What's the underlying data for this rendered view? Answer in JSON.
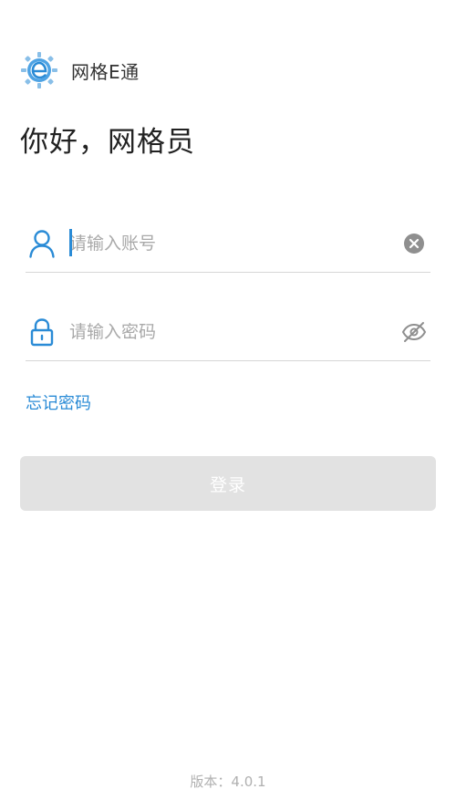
{
  "app": {
    "name": "网格E通"
  },
  "greeting": "你好，网格员",
  "account": {
    "placeholder": "请输入账号",
    "value": ""
  },
  "password": {
    "placeholder": "请输入密码",
    "value": ""
  },
  "forgot_password": "忘记密码",
  "login_button": "登录",
  "version": "版本：4.0.1",
  "colors": {
    "accent": "#2a8bd6",
    "button_disabled": "#e2e2e2",
    "divider": "#d6d6d6",
    "placeholder": "#a9a9a9"
  },
  "icons": {
    "logo": "e-logo-icon",
    "account": "user-icon",
    "clear": "clear-icon",
    "password": "lock-icon",
    "visibility": "eye-off-icon"
  }
}
